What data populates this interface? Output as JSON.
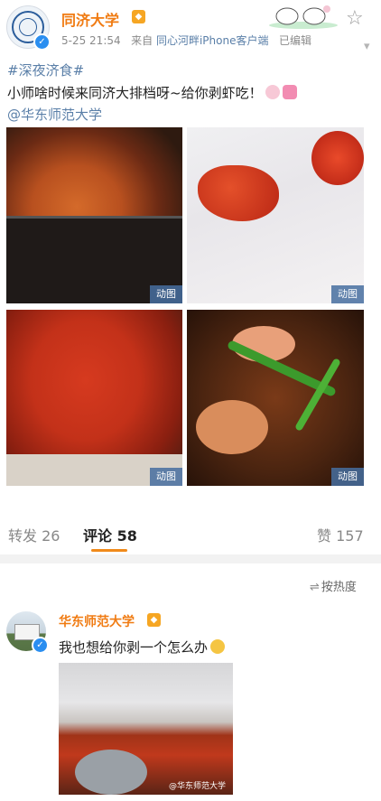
{
  "post": {
    "author": "同济大学",
    "date": "5-25 21:54",
    "source_prefix": "来自",
    "client": "同心河畔iPhone客户端",
    "edited": "已编辑",
    "topic": "#深夜济食#",
    "text": "小师啥时候来同济大排档呀~给你剥虾吃！",
    "mention": "@华东师范大学",
    "images": [
      {
        "tag": "动图"
      },
      {
        "tag": "动图"
      },
      {
        "tag": "动图"
      },
      {
        "tag": "动图"
      }
    ]
  },
  "tabs": {
    "repost": "转发 26",
    "comment": "评论 58",
    "like": "赞 157"
  },
  "sort": {
    "icon": "sort-icon",
    "label": "按热度"
  },
  "comment": {
    "author": "华东师范大学",
    "text": "我也想给你剥一个怎么办",
    "watermark": "@华东师范大学"
  },
  "colors": {
    "author": "#f07b12",
    "link": "#5a7fa8",
    "accent": "#f08a1a",
    "verify": "#2a8ef0"
  }
}
